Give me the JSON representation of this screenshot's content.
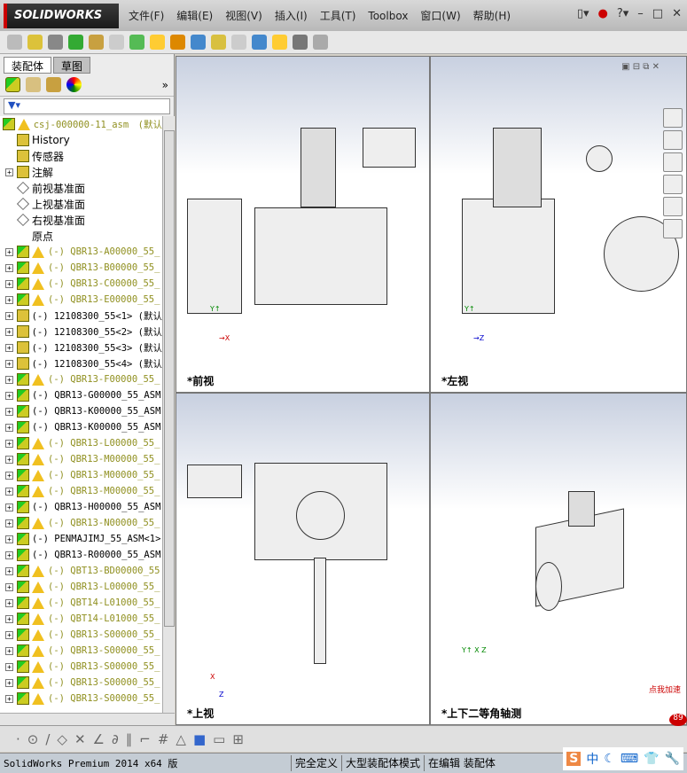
{
  "app": {
    "logo": "SOLIDWORKS",
    "menu": [
      "文件(F)",
      "编辑(E)",
      "视图(V)",
      "插入(I)",
      "工具(T)",
      "Toolbox",
      "窗口(W)",
      "帮助(H)"
    ]
  },
  "panel": {
    "tabs": [
      "装配体",
      "草图"
    ],
    "filter_icon": "filter-icon"
  },
  "tree": [
    {
      "label": "csj-000000-11_asm　(默认",
      "type": "asm",
      "warn": true,
      "plus": false
    },
    {
      "label": "History",
      "type": "folder",
      "warn": false,
      "plus": false,
      "plain": true
    },
    {
      "label": "传感器",
      "type": "folder",
      "warn": false,
      "plus": false,
      "plain": true
    },
    {
      "label": "注解",
      "type": "folder",
      "warn": false,
      "plus": true,
      "plain": true
    },
    {
      "label": "前视基准面",
      "type": "plane",
      "warn": false,
      "plus": false,
      "plain": true
    },
    {
      "label": "上视基准面",
      "type": "plane",
      "warn": false,
      "plus": false,
      "plain": true
    },
    {
      "label": "右视基准面",
      "type": "plane",
      "warn": false,
      "plus": false,
      "plain": true
    },
    {
      "label": "原点",
      "type": "origin",
      "warn": false,
      "plus": false,
      "plain": true
    },
    {
      "label": "(-) QBR13-A00000_55_",
      "type": "asm",
      "warn": true,
      "plus": true
    },
    {
      "label": "(-) QBR13-B00000_55_",
      "type": "asm",
      "warn": true,
      "plus": true
    },
    {
      "label": "(-) QBR13-C00000_55_",
      "type": "asm",
      "warn": true,
      "plus": true
    },
    {
      "label": "(-) QBR13-E00000_55_",
      "type": "asm",
      "warn": true,
      "plus": true
    },
    {
      "label": "(-) 12108300_55<1> (默认",
      "type": "part",
      "warn": false,
      "plus": true
    },
    {
      "label": "(-) 12108300_55<2> (默认",
      "type": "part",
      "warn": false,
      "plus": true
    },
    {
      "label": "(-) 12108300_55<3> (默认",
      "type": "part",
      "warn": false,
      "plus": true
    },
    {
      "label": "(-) 12108300_55<4> (默认",
      "type": "part",
      "warn": false,
      "plus": true
    },
    {
      "label": "(-) QBR13-F00000_55_",
      "type": "asm",
      "warn": true,
      "plus": true
    },
    {
      "label": "(-) QBR13-G00000_55_ASM",
      "type": "asm",
      "warn": false,
      "plus": true
    },
    {
      "label": "(-) QBR13-K00000_55_ASM",
      "type": "asm",
      "warn": false,
      "plus": true
    },
    {
      "label": "(-) QBR13-K00000_55_ASM",
      "type": "asm",
      "warn": false,
      "plus": true
    },
    {
      "label": "(-) QBR13-L00000_55_",
      "type": "asm",
      "warn": true,
      "plus": true
    },
    {
      "label": "(-) QBR13-M00000_55_",
      "type": "asm",
      "warn": true,
      "plus": true
    },
    {
      "label": "(-) QBR13-M00000_55_",
      "type": "asm",
      "warn": true,
      "plus": true
    },
    {
      "label": "(-) QBR13-M00000_55_",
      "type": "asm",
      "warn": true,
      "plus": true
    },
    {
      "label": "(-) QBR13-H00000_55_ASM",
      "type": "asm",
      "warn": false,
      "plus": true
    },
    {
      "label": "(-) QBR13-N00000_55_",
      "type": "asm",
      "warn": true,
      "plus": true
    },
    {
      "label": "(-) PENMAJIMJ_55_ASM<1>",
      "type": "asm",
      "warn": false,
      "plus": true
    },
    {
      "label": "(-) QBR13-R00000_55_ASM",
      "type": "asm",
      "warn": false,
      "plus": true
    },
    {
      "label": "(-) QBT13-BD00000_55",
      "type": "asm",
      "warn": true,
      "plus": true
    },
    {
      "label": "(-) QBR13-L00000_55_",
      "type": "asm",
      "warn": true,
      "plus": true
    },
    {
      "label": "(-) QBT14-L01000_55_",
      "type": "asm",
      "warn": true,
      "plus": true
    },
    {
      "label": "(-) QBT14-L01000_55_",
      "type": "asm",
      "warn": true,
      "plus": true
    },
    {
      "label": "(-) QBR13-S00000_55_",
      "type": "asm",
      "warn": true,
      "plus": true
    },
    {
      "label": "(-) QBR13-S00000_55_",
      "type": "asm",
      "warn": true,
      "plus": true
    },
    {
      "label": "(-) QBR13-S00000_55_",
      "type": "asm",
      "warn": true,
      "plus": true
    },
    {
      "label": "(-) QBR13-S00000_55_",
      "type": "asm",
      "warn": true,
      "plus": true
    },
    {
      "label": "(-) QBR13-S00000_55_",
      "type": "asm",
      "warn": true,
      "plus": true
    }
  ],
  "viewports": [
    {
      "label": "*前视",
      "axes": [
        "Y",
        "X"
      ]
    },
    {
      "label": "*左视",
      "axes": [
        "Y",
        "Z"
      ]
    },
    {
      "label": "*上视",
      "axes": [
        "X",
        "Z"
      ]
    },
    {
      "label": "*上下二等角轴测",
      "axes": [
        "Y",
        "X",
        "Z"
      ]
    }
  ],
  "status": {
    "product": "SolidWorks Premium 2014 x64 版",
    "items": [
      "完全定义",
      "大型装配体模式",
      "在编辑 装配体"
    ]
  },
  "ime": {
    "mode": "中",
    "badge": "点我加速",
    "count": "89"
  },
  "colors": {
    "warning_text": "#909020",
    "accent": "#c00000"
  }
}
